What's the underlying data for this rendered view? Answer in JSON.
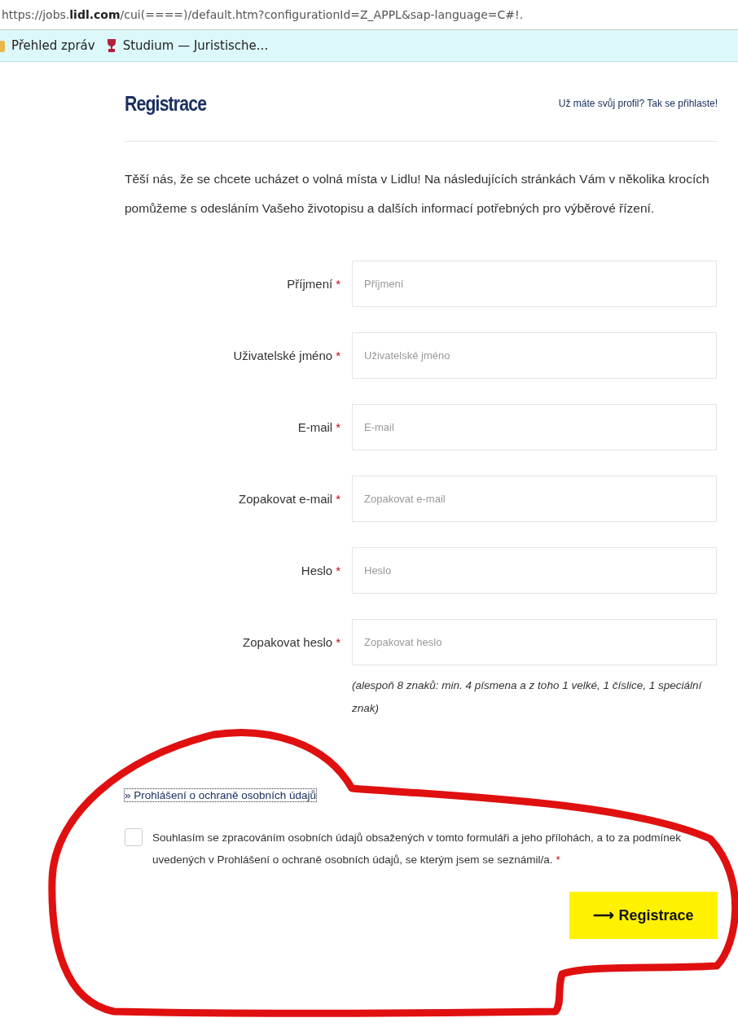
{
  "address_bar": {
    "prefix": "https://jobs.",
    "domain": "lidl.com",
    "rest": "/cui(====)/default.htm?configurationId=Z_APPL&sap-language=C#!."
  },
  "bookmarks": [
    {
      "label": "Přehled zpráv",
      "kind": "folder"
    },
    {
      "label": "Studium — Juristische...",
      "kind": "site"
    }
  ],
  "header": {
    "title": "Registrace",
    "login_link": "Už máte svůj profil? Tak se přihlaste!"
  },
  "intro": "Těší nás, že se chcete ucházet o volná místa v Lidlu! Na následujících stránkách Vám v několika krocích pomůžeme s odesláním Vašeho životopisu a dalších informací potřebných pro výběrové řízení.",
  "fields": [
    {
      "label": "Příjmení",
      "mark": "*",
      "placeholder": "Příjmení"
    },
    {
      "label": "Uživatelské jméno",
      "mark": "*",
      "placeholder": "Uživatelské jméno"
    },
    {
      "label": "E-mail",
      "mark": "*",
      "placeholder": "E-mail"
    },
    {
      "label": "Zopakovat e-mail",
      "mark": "*",
      "placeholder": "Zopakovat e-mail"
    },
    {
      "label": "Heslo",
      "mark": "*",
      "placeholder": "Heslo"
    },
    {
      "label": "Zopakovat heslo",
      "mark": "*",
      "placeholder": "Zopakovat heslo"
    }
  ],
  "password_hint": "(alespoň 8 znaků: min. 4 písmena a z toho 1 velké, 1 číslice, 1 speciální znak)",
  "privacy_link": "» Prohlášení o ochraně osobních údajů",
  "consent": {
    "text": "Souhlasím se zpracováním osobních údajů obsažených v tomto formuláři a jeho přílohách, a to za podmínek uvedených v Prohlášení o ochraně osobních údajů, se kterým jsem se seznámil/a.",
    "mark": "*",
    "checked": false
  },
  "submit": {
    "arrow": "⟶",
    "label": "Registrace"
  }
}
